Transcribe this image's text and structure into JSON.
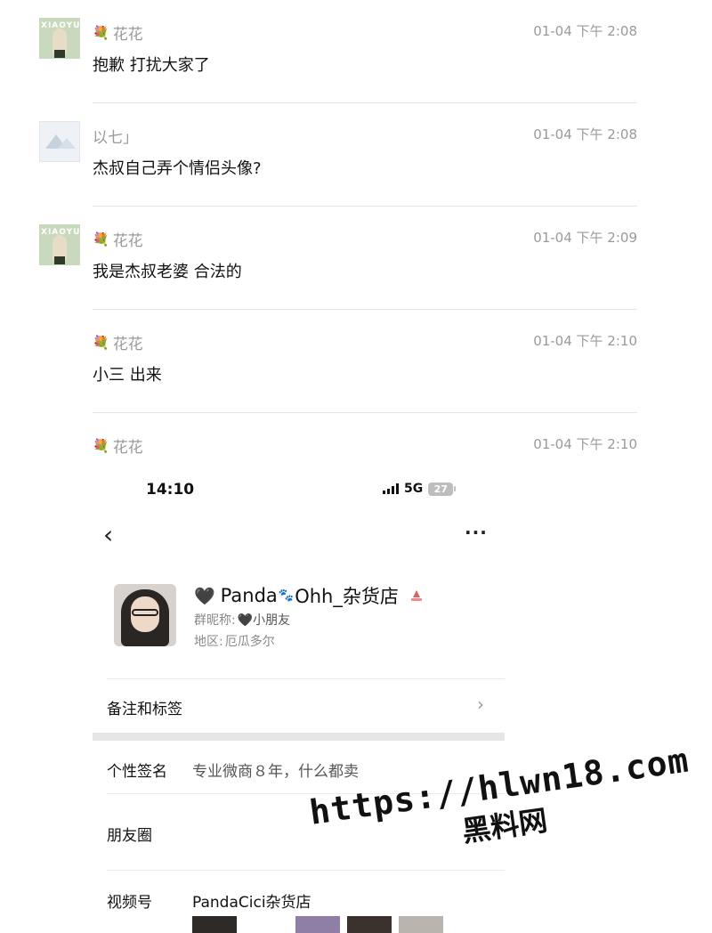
{
  "messages": [
    {
      "avatar": "cartoon",
      "avatar_text": "XIAOYU",
      "icon": "flower-icon",
      "name": "花花",
      "time": "01-04 下午 2:08",
      "text": "抱歉  打扰大家了"
    },
    {
      "avatar": "placeholder",
      "avatar_text": "",
      "icon": "",
      "name": "以七」",
      "time": "01-04 下午 2:08",
      "text": "杰叔自己弄个情侣头像?"
    },
    {
      "avatar": "cartoon",
      "avatar_text": "XIAOYU",
      "icon": "flower-icon",
      "name": "花花",
      "time": "01-04 下午 2:09",
      "text": "我是杰叔老婆  合法的"
    },
    {
      "avatar": "none",
      "avatar_text": "",
      "icon": "flower-icon",
      "name": "花花",
      "time": "01-04 下午 2:10",
      "text": "小三  出来"
    },
    {
      "avatar": "none",
      "avatar_text": "",
      "icon": "flower-icon",
      "name": "花花",
      "time": "01-04 下午 2:10",
      "text": ""
    }
  ],
  "phone": {
    "status": {
      "time": "14:10",
      "network": "5G",
      "battery": "27"
    },
    "profile": {
      "name_prefix": "🖤",
      "name_a": "Panda",
      "name_paw": "🐾",
      "name_b": "Ohh_杂货店",
      "group_nick_label": "群昵称:",
      "group_nick_value": "🖤小朋友",
      "region_label": "地区:",
      "region_value": "厄瓜多尔"
    },
    "rows": {
      "remarks_label": "备注和标签",
      "signature_label": "个性签名",
      "signature_value": "专业微商８年，什么都卖",
      "moments_label": "朋友圈",
      "channels_label": "视频号",
      "channels_value": "PandaCici杂货店"
    }
  },
  "watermark": {
    "url": "https://hlwn18.com",
    "text": "黑料网"
  },
  "colors": {
    "meta_gray": "#9a9a9a",
    "divider": "#e6e6e6",
    "vip_icon": "#e0605a"
  }
}
